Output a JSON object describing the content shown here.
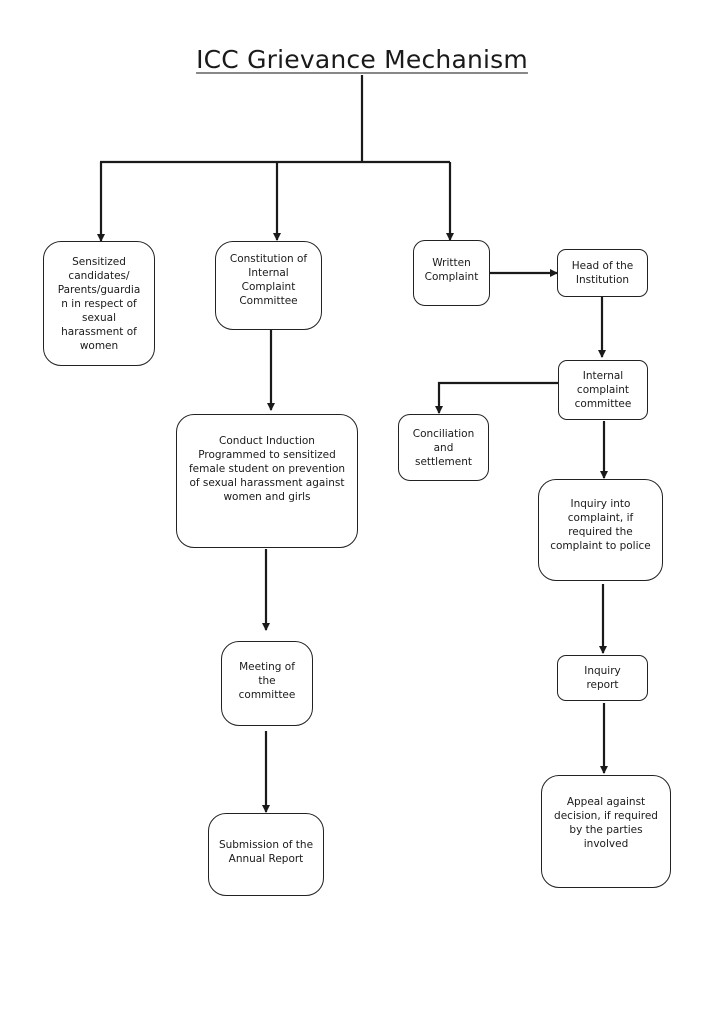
{
  "title": "ICC Grievance Mechanism",
  "nodes": {
    "sensitized": "Sensitized\ncandidates/\nParents/guardia\nn in respect of\nsexual\nharassment of\nwomen",
    "constitution": "Constitution of\nInternal\nComplaint\nCommittee",
    "induction": "Conduct Induction\nProgrammed to sensitized\nfemale student on prevention\nof sexual harassment against\nwomen and girls",
    "meeting": "Meeting of\nthe\ncommittee",
    "annual_report": "Submission of the\nAnnual Report",
    "written_complaint": "Written\nComplaint",
    "head": "Head of the\nInstitution",
    "icc": "Internal\ncomplaint\ncommittee",
    "conciliation": "Conciliation\nand\nsettlement",
    "inquiry": "Inquiry into\ncomplaint, if\nrequired the\ncomplaint to police",
    "inquiry_report": "Inquiry\nreport",
    "appeal": "Appeal against\ndecision, if required\nby the parties\ninvolved"
  }
}
